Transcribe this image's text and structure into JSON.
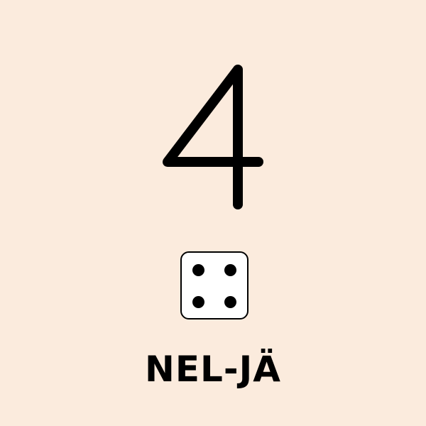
{
  "colors": {
    "background": "#fbebdd",
    "ink": "#000000",
    "die_face": "#ffffff"
  },
  "card": {
    "numeral": "4",
    "die_value": 4,
    "word": "NEL-JÄ"
  }
}
